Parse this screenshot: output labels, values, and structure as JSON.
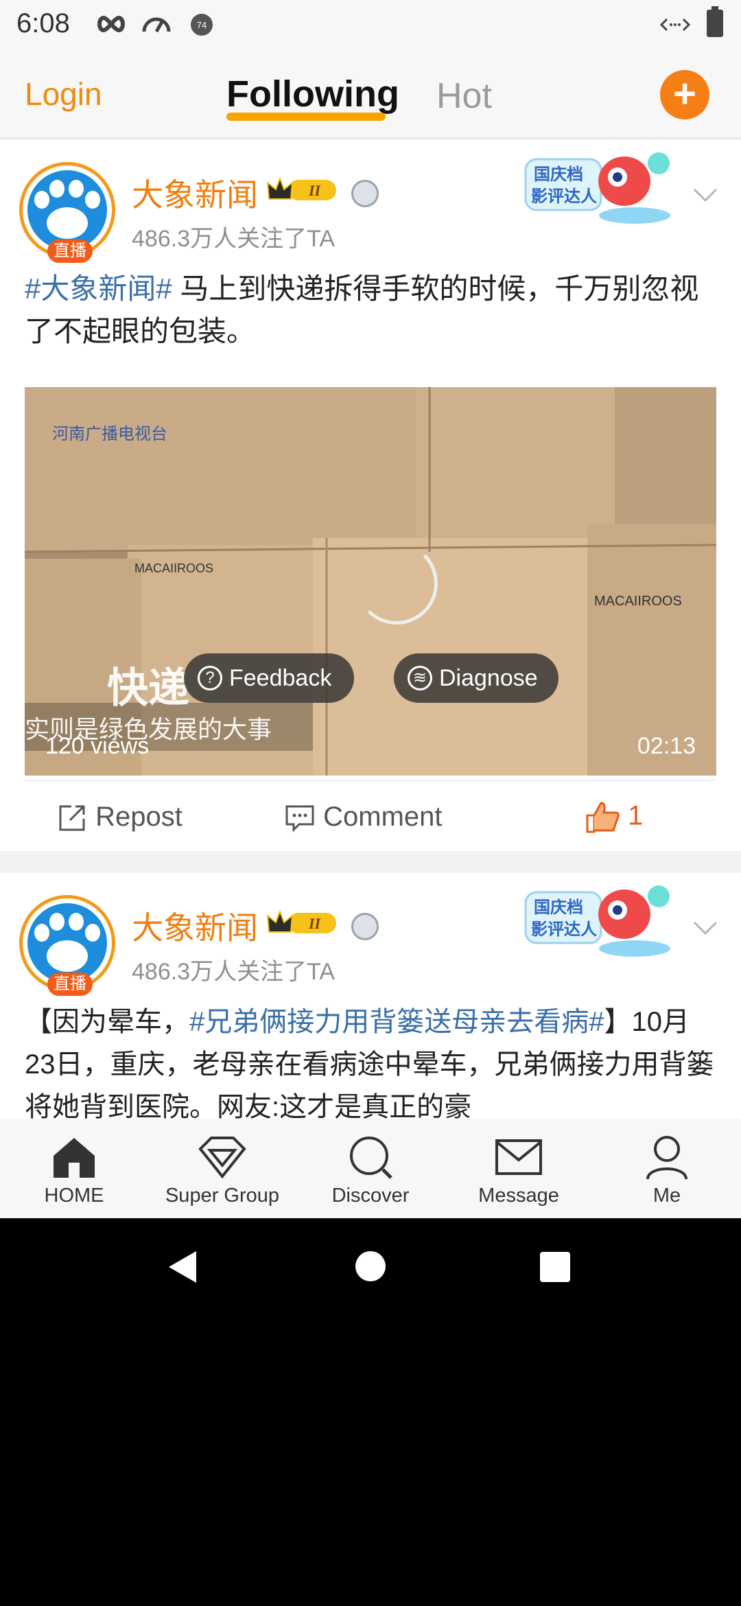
{
  "status_bar": {
    "time": "6:08"
  },
  "top_nav": {
    "login": "Login",
    "tab_following": "Following",
    "tab_hot": "Hot",
    "add_symbol": "+"
  },
  "posts": [
    {
      "author": "大象新闻",
      "live_badge": "直播",
      "followers": "486.3万人关注了TA",
      "tag": "#大象新闻#",
      "text": " 马上到快递拆得手软的时候，千万别忽视了不起眼的包装。",
      "video": {
        "subtitle_line1": "快递",
        "subtitle_line2": "实则是绿色发展的大事",
        "feedback": "Feedback",
        "diagnose": "Diagnose",
        "views": "120 views",
        "duration": "02:13"
      },
      "actions": {
        "repost": "Repost",
        "comment": "Comment",
        "like_count": "1"
      }
    },
    {
      "author": "大象新闻",
      "live_badge": "直播",
      "followers": "486.3万人关注了TA",
      "text_prefix": "【因为晕车，",
      "tag": "#兄弟俩接力用背篓送母亲去看病#",
      "text_suffix": "】10月23日，重庆，老母亲在看病途中晕车，兄弟俩接力用背篓将她背到医院。网友:这才是真正的豪"
    }
  ],
  "tabbar": [
    {
      "label": "HOME",
      "icon": "home-icon"
    },
    {
      "label": "Super Group",
      "icon": "diamond-icon"
    },
    {
      "label": "Discover",
      "icon": "search-icon"
    },
    {
      "label": "Message",
      "icon": "mail-icon"
    },
    {
      "label": "Me",
      "icon": "person-icon"
    }
  ],
  "colors": {
    "accent": "#f57f15",
    "author": "#f07e10",
    "tag": "#3a6fa8",
    "tab_underline": "#f9a400"
  }
}
